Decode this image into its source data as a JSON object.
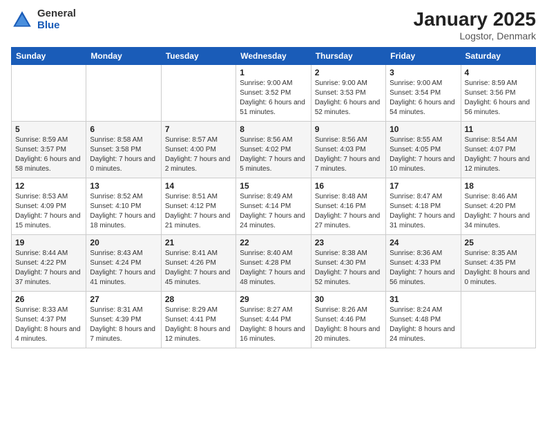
{
  "header": {
    "logo_general": "General",
    "logo_blue": "Blue",
    "month_title": "January 2025",
    "location": "Logstor, Denmark"
  },
  "weekdays": [
    "Sunday",
    "Monday",
    "Tuesday",
    "Wednesday",
    "Thursday",
    "Friday",
    "Saturday"
  ],
  "weeks": [
    [
      {
        "day": "",
        "sunrise": "",
        "sunset": "",
        "daylight": ""
      },
      {
        "day": "",
        "sunrise": "",
        "sunset": "",
        "daylight": ""
      },
      {
        "day": "",
        "sunrise": "",
        "sunset": "",
        "daylight": ""
      },
      {
        "day": "1",
        "sunrise": "Sunrise: 9:00 AM",
        "sunset": "Sunset: 3:52 PM",
        "daylight": "Daylight: 6 hours and 51 minutes."
      },
      {
        "day": "2",
        "sunrise": "Sunrise: 9:00 AM",
        "sunset": "Sunset: 3:53 PM",
        "daylight": "Daylight: 6 hours and 52 minutes."
      },
      {
        "day": "3",
        "sunrise": "Sunrise: 9:00 AM",
        "sunset": "Sunset: 3:54 PM",
        "daylight": "Daylight: 6 hours and 54 minutes."
      },
      {
        "day": "4",
        "sunrise": "Sunrise: 8:59 AM",
        "sunset": "Sunset: 3:56 PM",
        "daylight": "Daylight: 6 hours and 56 minutes."
      }
    ],
    [
      {
        "day": "5",
        "sunrise": "Sunrise: 8:59 AM",
        "sunset": "Sunset: 3:57 PM",
        "daylight": "Daylight: 6 hours and 58 minutes."
      },
      {
        "day": "6",
        "sunrise": "Sunrise: 8:58 AM",
        "sunset": "Sunset: 3:58 PM",
        "daylight": "Daylight: 7 hours and 0 minutes."
      },
      {
        "day": "7",
        "sunrise": "Sunrise: 8:57 AM",
        "sunset": "Sunset: 4:00 PM",
        "daylight": "Daylight: 7 hours and 2 minutes."
      },
      {
        "day": "8",
        "sunrise": "Sunrise: 8:56 AM",
        "sunset": "Sunset: 4:02 PM",
        "daylight": "Daylight: 7 hours and 5 minutes."
      },
      {
        "day": "9",
        "sunrise": "Sunrise: 8:56 AM",
        "sunset": "Sunset: 4:03 PM",
        "daylight": "Daylight: 7 hours and 7 minutes."
      },
      {
        "day": "10",
        "sunrise": "Sunrise: 8:55 AM",
        "sunset": "Sunset: 4:05 PM",
        "daylight": "Daylight: 7 hours and 10 minutes."
      },
      {
        "day": "11",
        "sunrise": "Sunrise: 8:54 AM",
        "sunset": "Sunset: 4:07 PM",
        "daylight": "Daylight: 7 hours and 12 minutes."
      }
    ],
    [
      {
        "day": "12",
        "sunrise": "Sunrise: 8:53 AM",
        "sunset": "Sunset: 4:09 PM",
        "daylight": "Daylight: 7 hours and 15 minutes."
      },
      {
        "day": "13",
        "sunrise": "Sunrise: 8:52 AM",
        "sunset": "Sunset: 4:10 PM",
        "daylight": "Daylight: 7 hours and 18 minutes."
      },
      {
        "day": "14",
        "sunrise": "Sunrise: 8:51 AM",
        "sunset": "Sunset: 4:12 PM",
        "daylight": "Daylight: 7 hours and 21 minutes."
      },
      {
        "day": "15",
        "sunrise": "Sunrise: 8:49 AM",
        "sunset": "Sunset: 4:14 PM",
        "daylight": "Daylight: 7 hours and 24 minutes."
      },
      {
        "day": "16",
        "sunrise": "Sunrise: 8:48 AM",
        "sunset": "Sunset: 4:16 PM",
        "daylight": "Daylight: 7 hours and 27 minutes."
      },
      {
        "day": "17",
        "sunrise": "Sunrise: 8:47 AM",
        "sunset": "Sunset: 4:18 PM",
        "daylight": "Daylight: 7 hours and 31 minutes."
      },
      {
        "day": "18",
        "sunrise": "Sunrise: 8:46 AM",
        "sunset": "Sunset: 4:20 PM",
        "daylight": "Daylight: 7 hours and 34 minutes."
      }
    ],
    [
      {
        "day": "19",
        "sunrise": "Sunrise: 8:44 AM",
        "sunset": "Sunset: 4:22 PM",
        "daylight": "Daylight: 7 hours and 37 minutes."
      },
      {
        "day": "20",
        "sunrise": "Sunrise: 8:43 AM",
        "sunset": "Sunset: 4:24 PM",
        "daylight": "Daylight: 7 hours and 41 minutes."
      },
      {
        "day": "21",
        "sunrise": "Sunrise: 8:41 AM",
        "sunset": "Sunset: 4:26 PM",
        "daylight": "Daylight: 7 hours and 45 minutes."
      },
      {
        "day": "22",
        "sunrise": "Sunrise: 8:40 AM",
        "sunset": "Sunset: 4:28 PM",
        "daylight": "Daylight: 7 hours and 48 minutes."
      },
      {
        "day": "23",
        "sunrise": "Sunrise: 8:38 AM",
        "sunset": "Sunset: 4:30 PM",
        "daylight": "Daylight: 7 hours and 52 minutes."
      },
      {
        "day": "24",
        "sunrise": "Sunrise: 8:36 AM",
        "sunset": "Sunset: 4:33 PM",
        "daylight": "Daylight: 7 hours and 56 minutes."
      },
      {
        "day": "25",
        "sunrise": "Sunrise: 8:35 AM",
        "sunset": "Sunset: 4:35 PM",
        "daylight": "Daylight: 8 hours and 0 minutes."
      }
    ],
    [
      {
        "day": "26",
        "sunrise": "Sunrise: 8:33 AM",
        "sunset": "Sunset: 4:37 PM",
        "daylight": "Daylight: 8 hours and 4 minutes."
      },
      {
        "day": "27",
        "sunrise": "Sunrise: 8:31 AM",
        "sunset": "Sunset: 4:39 PM",
        "daylight": "Daylight: 8 hours and 7 minutes."
      },
      {
        "day": "28",
        "sunrise": "Sunrise: 8:29 AM",
        "sunset": "Sunset: 4:41 PM",
        "daylight": "Daylight: 8 hours and 12 minutes."
      },
      {
        "day": "29",
        "sunrise": "Sunrise: 8:27 AM",
        "sunset": "Sunset: 4:44 PM",
        "daylight": "Daylight: 8 hours and 16 minutes."
      },
      {
        "day": "30",
        "sunrise": "Sunrise: 8:26 AM",
        "sunset": "Sunset: 4:46 PM",
        "daylight": "Daylight: 8 hours and 20 minutes."
      },
      {
        "day": "31",
        "sunrise": "Sunrise: 8:24 AM",
        "sunset": "Sunset: 4:48 PM",
        "daylight": "Daylight: 8 hours and 24 minutes."
      },
      {
        "day": "",
        "sunrise": "",
        "sunset": "",
        "daylight": ""
      }
    ]
  ]
}
